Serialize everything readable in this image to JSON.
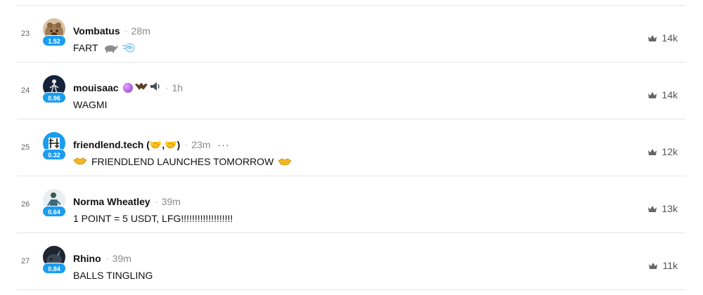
{
  "feed": {
    "separator": "·",
    "rows": [
      {
        "rank": "23",
        "username": "Vombatus",
        "time": "28m",
        "text": "FART",
        "price": "1.52",
        "count": "14k",
        "avatar_color": "#a07a52"
      },
      {
        "rank": "24",
        "username": "mouisaac",
        "time": "1h",
        "text": "WAGMI",
        "price": "0.96",
        "count": "14k",
        "avatar_color": "#14223a"
      },
      {
        "rank": "25",
        "username": "friendlend.tech (🤝,🤝)",
        "time": "23m",
        "more": "···",
        "text": "FRIENDLEND LAUNCHES TOMORROW",
        "price": "0.32",
        "count": "12k",
        "avatar_color": "#1a9df0"
      },
      {
        "rank": "26",
        "username": "Norma Wheatley",
        "time": "39m",
        "text": "1 POINT = 5 USDT, LFG!!!!!!!!!!!!!!!!!!!",
        "price": "0.64",
        "count": "13k",
        "avatar_color": "#e8eef2"
      },
      {
        "rank": "27",
        "username": "Rhino",
        "time": "39m",
        "text": "BALLS TINGLING",
        "price": "0.84",
        "count": "11k",
        "avatar_color": "#1c2530"
      }
    ]
  },
  "icons": {
    "stat_icon": "crown-icon",
    "accent": "#1a9df0"
  }
}
